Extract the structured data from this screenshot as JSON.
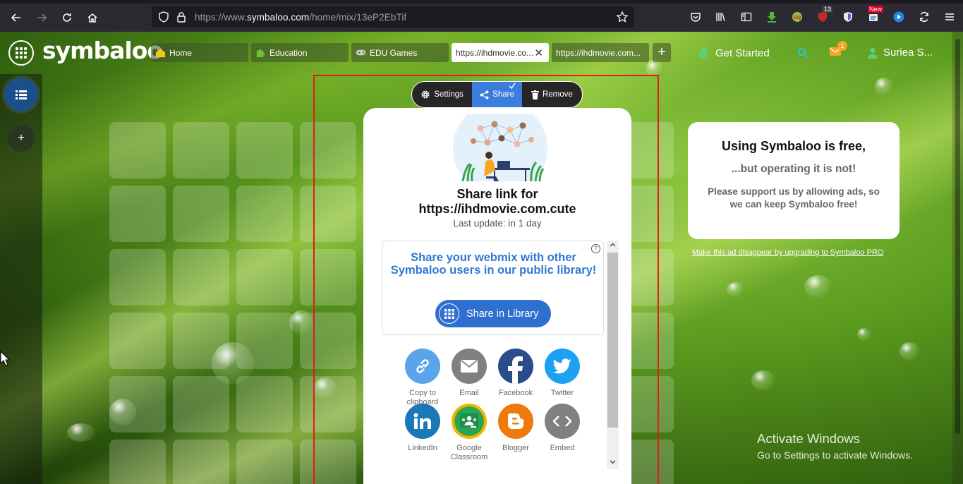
{
  "browser": {
    "url_prefix": "https://www.",
    "url_domain": "symbaloo.com",
    "url_path": "/home/mix/13eP2EbTif",
    "badge_count": "13",
    "badge_new": "New"
  },
  "header": {
    "logo": "symbaloo",
    "tabs": [
      {
        "label": "Home"
      },
      {
        "label": "Education"
      },
      {
        "label": "EDU Games"
      },
      {
        "label": "https://ihdmovie.co..."
      },
      {
        "label": "https://ihdmovie.com..."
      }
    ],
    "get_started": "Get Started",
    "mail_count": "1",
    "user_name": "Suriea S..."
  },
  "actions": {
    "settings": "Settings",
    "share": "Share",
    "remove": "Remove"
  },
  "share_panel": {
    "title_line1": "Share link for",
    "title_line2": "https://ihdmovie.com.cute",
    "last_update": "Last update: in 1 day",
    "library_text": "Share your webmix with other Symbaloo users in our public library!",
    "library_button": "Share in Library",
    "help": "?",
    "options": [
      {
        "label": "Copy to clipboard",
        "color": "#5aa4ea"
      },
      {
        "label": "Email",
        "color": "#808080"
      },
      {
        "label": "Facebook",
        "color": "#2a4c8c"
      },
      {
        "label": "Twitter",
        "color": "#1da1f2"
      },
      {
        "label": "LinkedIn",
        "color": "#1a78b7"
      },
      {
        "label": "Google Classroom",
        "color": "#27a65a"
      },
      {
        "label": "Blogger",
        "color": "#f0790c"
      },
      {
        "label": "Embed",
        "color": "#808080"
      }
    ]
  },
  "ad": {
    "h1": "Using Symbaloo is free,",
    "h2": "...but operating it is not!",
    "h3": "Please support us by allowing ads, so we can keep Symbaloo free!",
    "link": "Make this ad disappear by upgrading to Symbaloo PRO"
  },
  "watermark": {
    "line1": "Activate Windows",
    "line2": "Go to Settings to activate Windows."
  },
  "sidebar": {
    "add": "+"
  }
}
